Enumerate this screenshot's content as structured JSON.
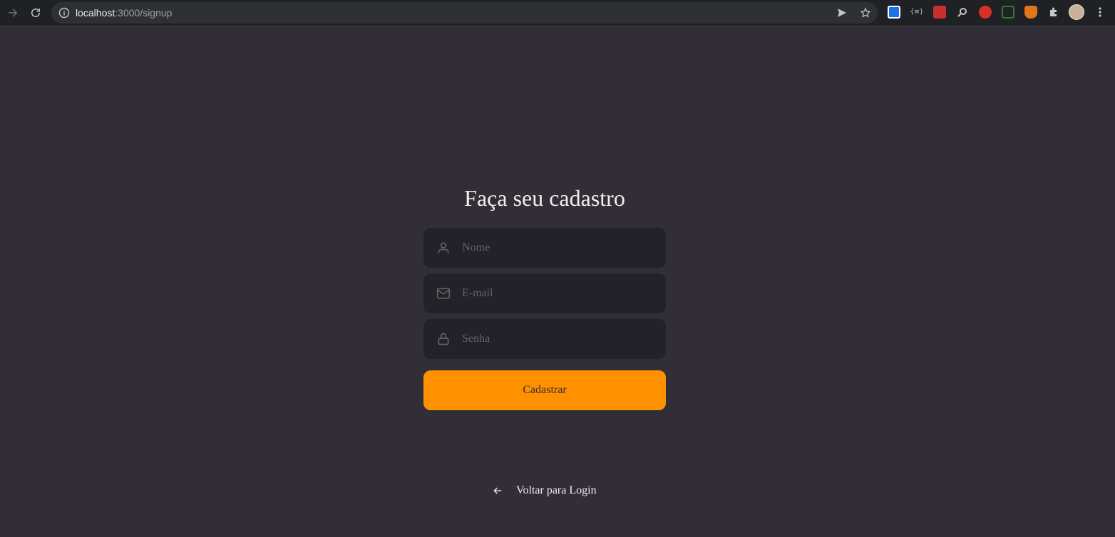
{
  "browser": {
    "url_host": "localhost",
    "url_path": ":3000/signup",
    "icons": [
      "forward-icon",
      "reload-icon",
      "info-icon",
      "send-icon",
      "star-icon",
      "extensions-icon",
      "avatar",
      "menu-icon"
    ]
  },
  "signup": {
    "title": "Faça seu cadastro",
    "name_placeholder": "Nome",
    "email_placeholder": "E-mail",
    "password_placeholder": "Senha",
    "submit_label": "Cadastrar",
    "back_label": "Voltar para Login"
  },
  "colors": {
    "background": "#312e38",
    "input_background": "#232129",
    "accent": "#ff9000",
    "text": "#f4ede8",
    "placeholder": "#666360"
  }
}
